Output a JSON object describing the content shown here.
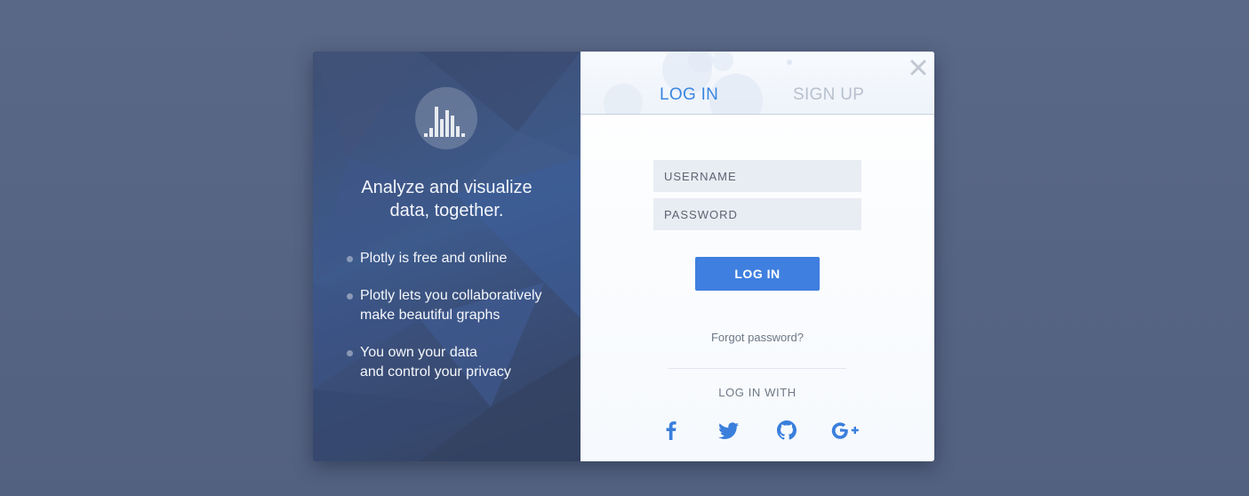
{
  "colors": {
    "backdrop": "#566482",
    "left_panel": "#3d5a8c",
    "accent": "#3f7fdf",
    "tab_active": "#3a86e0",
    "tab_inactive": "#b7c0cd",
    "field_bg": "#e8edf3",
    "social_icon": "#3a7fdc"
  },
  "left_panel": {
    "logo_icon": "bar-chart-icon",
    "headline_line1": "Analyze and visualize",
    "headline_line2": "data, together.",
    "bullets": [
      {
        "line1": "Plotly is free and online",
        "line2": ""
      },
      {
        "line1": "Plotly lets you collaboratively",
        "line2": "make beautiful graphs"
      },
      {
        "line1": "You own your data",
        "line2": "and control your privacy"
      }
    ]
  },
  "tabs": {
    "login": "LOG IN",
    "signup": "SIGN UP",
    "active": "login"
  },
  "close_icon": "close-icon",
  "form": {
    "username_placeholder": "USERNAME",
    "username_value": "",
    "password_placeholder": "PASSWORD",
    "password_value": "",
    "submit_label": "LOG IN",
    "forgot_label": "Forgot password?"
  },
  "social": {
    "heading": "LOG IN WITH",
    "providers": [
      {
        "name": "Facebook",
        "icon": "facebook-icon"
      },
      {
        "name": "Twitter",
        "icon": "twitter-icon"
      },
      {
        "name": "GitHub",
        "icon": "github-icon"
      },
      {
        "name": "Google+",
        "icon": "google-plus-icon"
      }
    ]
  }
}
